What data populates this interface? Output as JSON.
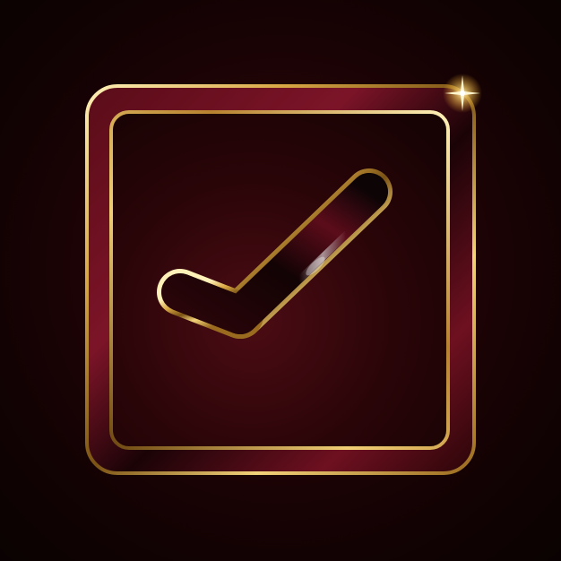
{
  "scene": {
    "icon": "checkbox-checked-icon",
    "mark": "checkmark-icon",
    "decoration": "sparkle-icon"
  },
  "colors": {
    "background_center": "#3a0a0c",
    "background_edge": "#0a0202",
    "gold_light": "#fff1b8",
    "gold_mid": "#d9a845",
    "gold_dark": "#7a5214",
    "burgundy": "#6e1020",
    "burgundy_dark": "#2a0508",
    "glass_black": "#0c0405"
  }
}
